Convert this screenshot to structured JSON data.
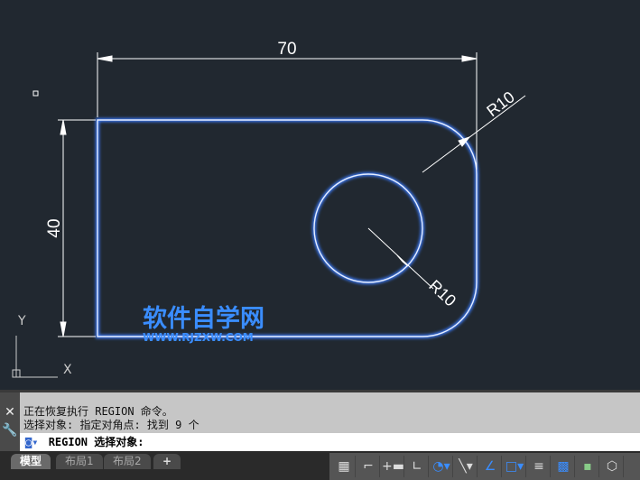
{
  "drawing": {
    "dim_horizontal": "70",
    "dim_vertical": "40",
    "radius_corner": "R10",
    "radius_circle": "R10",
    "axis_x": "X",
    "axis_y": "Y"
  },
  "watermark": {
    "title": "软件自学网",
    "url": "WWW.RJZXW.COM"
  },
  "command": {
    "history": [
      "正在恢复执行 REGION 命令。",
      "选择对象: 指定对角点: 找到 9 个"
    ],
    "prompt": "REGION 选择对象:"
  },
  "tabs": [
    {
      "label": "模型"
    },
    {
      "label": "布局1"
    },
    {
      "label": "布局2"
    },
    {
      "label": "+"
    }
  ],
  "status_icons": [
    "grid-icon",
    "snap-icon",
    "infer-icon",
    "ortho-icon",
    "polar-icon",
    "dropdown",
    "isodraft-icon",
    "dropdown",
    "osnap-tracking-icon",
    "osnap-icon",
    "dropdown",
    "lineweight-icon",
    "transparency-icon",
    "selection-cycling-icon",
    "3d-osnap-icon"
  ],
  "colors": {
    "background": "#212830",
    "geometry": "#c8dcff",
    "dimension": "#ffffff",
    "watermark": "#3a8dff"
  }
}
